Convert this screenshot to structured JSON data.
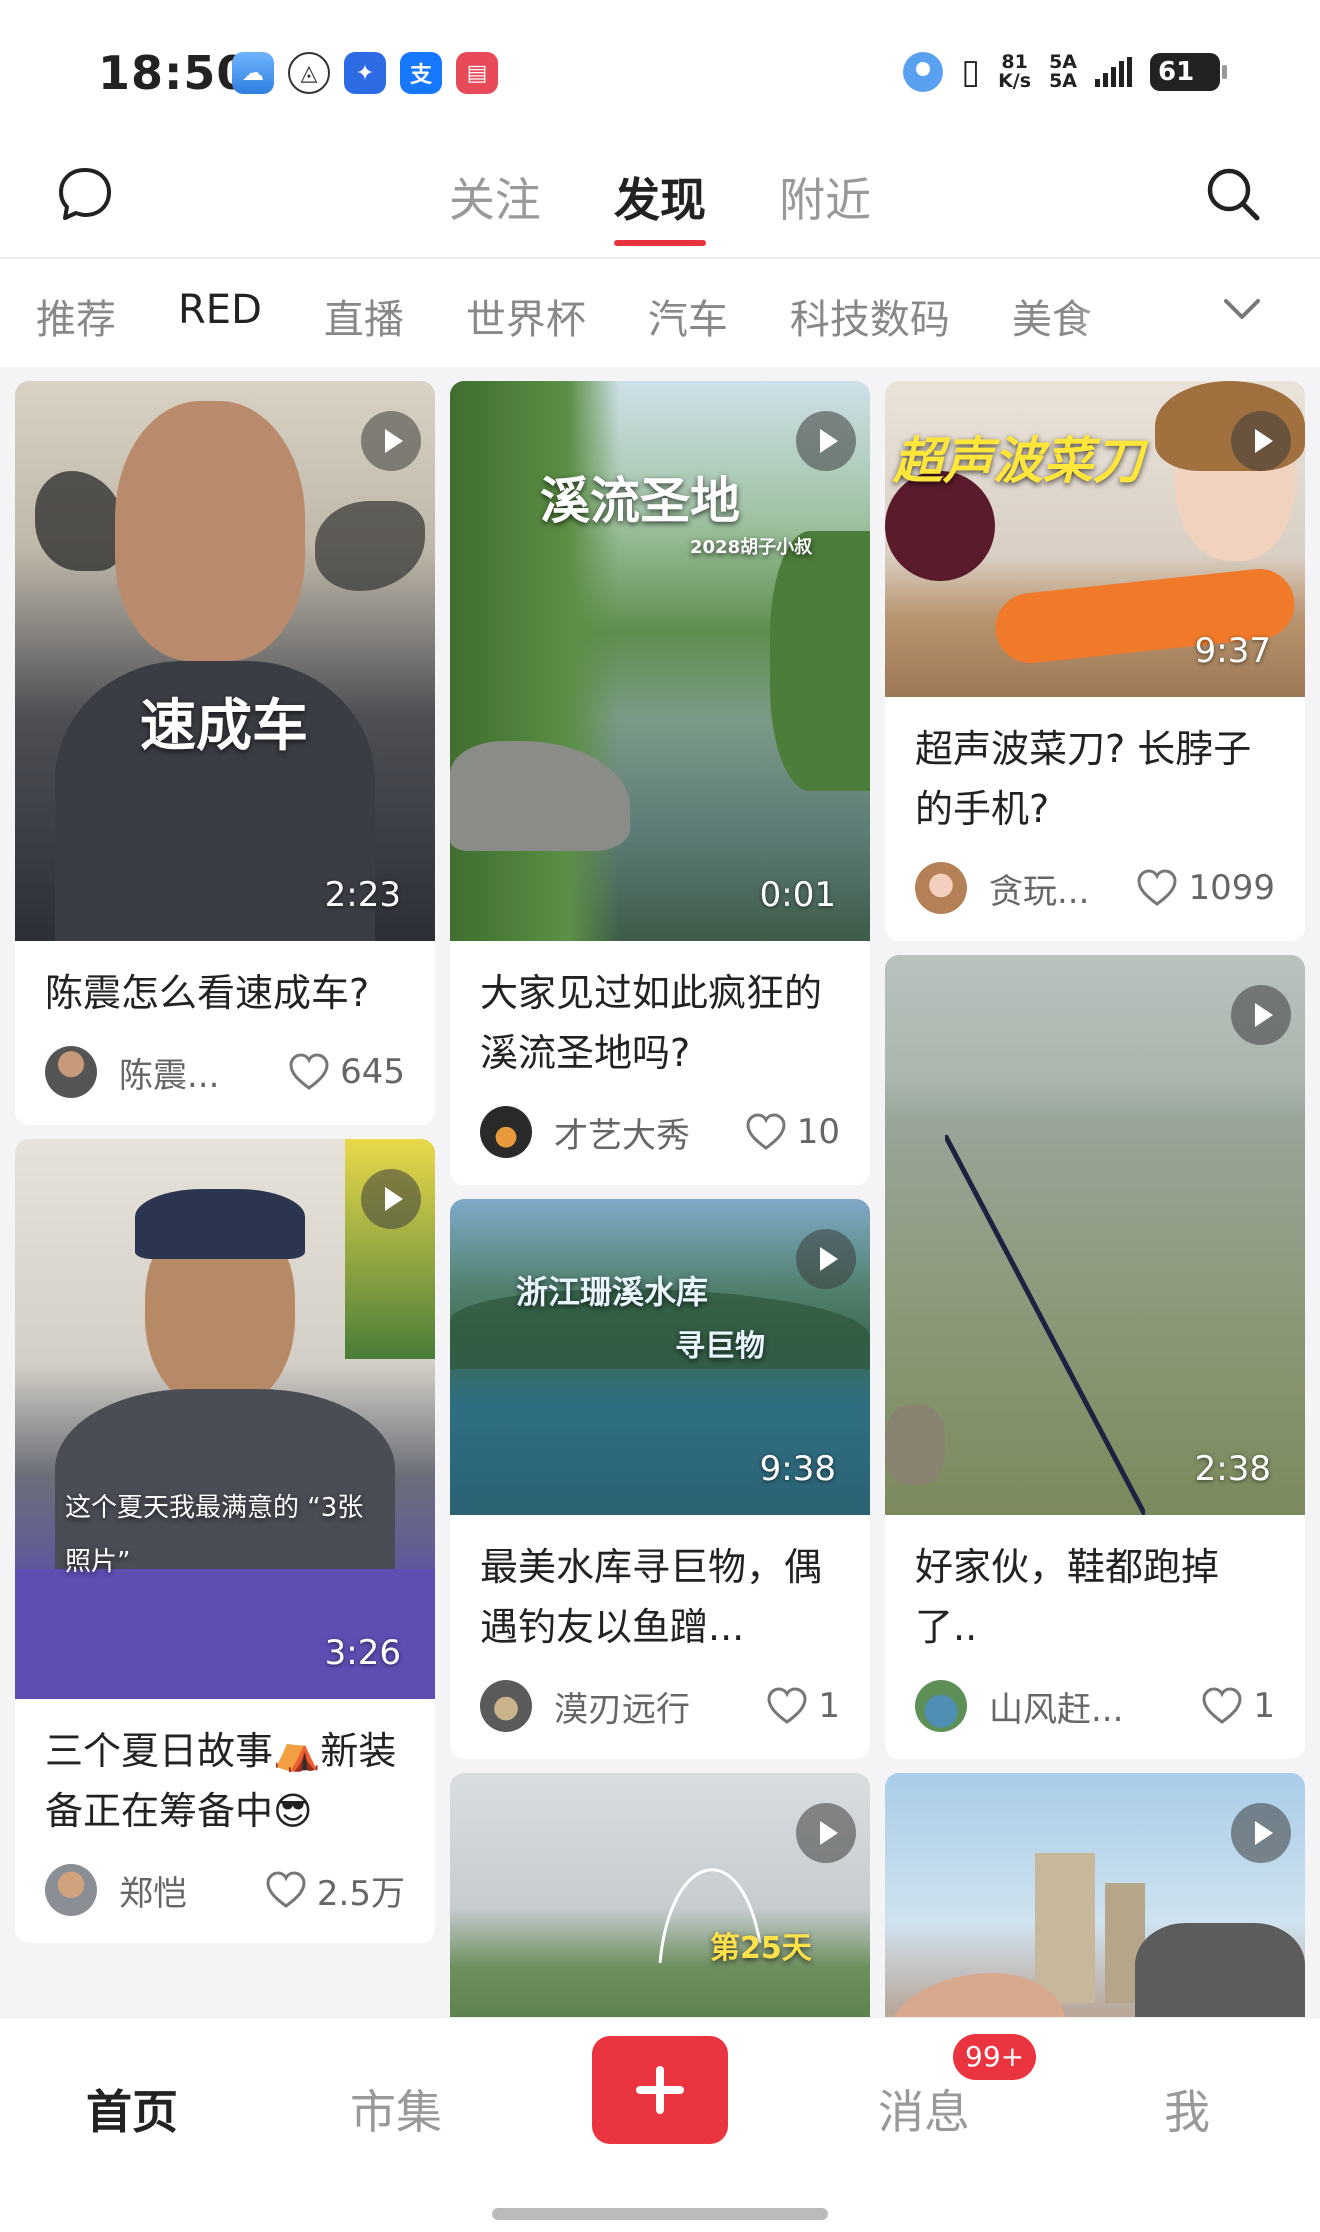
{
  "status_bar": {
    "time": "18:50",
    "net_speed_value": "81",
    "net_speed_unit": "K/s",
    "sim1": "5A",
    "sim2": "5A",
    "battery": "61",
    "app_icons": [
      {
        "name": "weather-icon",
        "color": "#4a90e2",
        "glyph": "☁"
      },
      {
        "name": "app-a-icon",
        "color": "#ffffff",
        "glyph": "Ⓐ"
      },
      {
        "name": "bulb-icon",
        "color": "#2d6be4",
        "glyph": "✦"
      },
      {
        "name": "alipay-icon",
        "color": "#1677ff",
        "glyph": "支"
      },
      {
        "name": "book-icon",
        "color": "#e84a5a",
        "glyph": "▤"
      }
    ]
  },
  "top_nav": {
    "tabs": [
      "关注",
      "发现",
      "附近"
    ],
    "active_tab": "发现"
  },
  "categories": {
    "items": [
      "推荐",
      "RED",
      "直播",
      "世界杯",
      "汽车",
      "科技数码",
      "美食"
    ],
    "active": "RED"
  },
  "feed": {
    "col1": [
      {
        "overlay": "速成车",
        "duration": "2:23",
        "title": "陈震怎么看速成车?",
        "author": "陈震...",
        "likes": "645"
      },
      {
        "overlay": "这个夏天我最满意的 “3张照片”",
        "duration": "3:26",
        "title": "三个夏日故事⛺新装备正在筹备中😎",
        "author": "郑恺",
        "likes": "2.5万"
      }
    ],
    "col2": [
      {
        "overlay": "溪流圣地",
        "overlay_sub": "2028胡子小叔",
        "duration": "0:01",
        "title": "大家见过如此疯狂的溪流圣地吗?",
        "author": "才艺大秀",
        "likes": "10"
      },
      {
        "overlay": "浙江珊溪水库",
        "overlay_sub": "寻巨物",
        "duration": "9:38",
        "title": "最美水库寻巨物，偶遇钓友以鱼蹭...",
        "author": "漠刃远行",
        "likes": "1"
      },
      {
        "overlay": "第25天",
        "duration": "",
        "title": "",
        "author": "",
        "likes": ""
      }
    ],
    "col3": [
      {
        "overlay": "超声波菜刀",
        "duration": "9:37",
        "title": "超声波菜刀? 长脖子的手机?",
        "author": "贪玩...",
        "likes": "1099"
      },
      {
        "overlay": "",
        "duration": "2:38",
        "title": "好家伙，鞋都跑掉了..",
        "author": "山风赶...",
        "likes": "1"
      },
      {
        "overlay": "",
        "duration": "",
        "title": "",
        "author": "",
        "likes": ""
      }
    ]
  },
  "bottom_nav": {
    "items": [
      "首页",
      "市集",
      "消息",
      "我"
    ],
    "active": "首页",
    "badge": "99+"
  },
  "colors": {
    "accent": "#e8323c",
    "background": "#f4f4f6"
  }
}
